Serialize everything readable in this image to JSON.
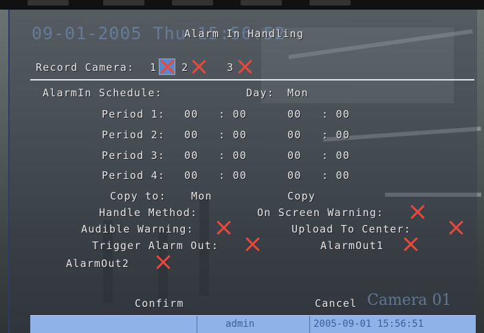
{
  "dialog": {
    "title": "Alarm In Handling",
    "osd_datetime": "09-01-2005 Thu 15:56:52",
    "osd_camera": "Camera 01"
  },
  "record_camera": {
    "label": "Record Camera:",
    "cameras": [
      "1",
      "2",
      "3"
    ],
    "selected": "1"
  },
  "schedule": {
    "label": "AlarmIn Schedule:",
    "day_label": "Day:",
    "day_value": "Mon",
    "periods": [
      {
        "label": "Period 1:",
        "start_h": "00",
        "start_m": ": 00",
        "end_h": "00",
        "end_m": ": 00"
      },
      {
        "label": "Period 2:",
        "start_h": "00",
        "start_m": ": 00",
        "end_h": "00",
        "end_m": ": 00"
      },
      {
        "label": "Period 3:",
        "start_h": "00",
        "start_m": ": 00",
        "end_h": "00",
        "end_m": ": 00"
      },
      {
        "label": "Period 4:",
        "start_h": "00",
        "start_m": ": 00",
        "end_h": "00",
        "end_m": ": 00"
      }
    ],
    "copy_to_label": "Copy to:",
    "copy_to_value": "Mon",
    "copy_button": "Copy"
  },
  "handle": {
    "method_label": "Handle Method:",
    "on_screen_warning": "On Screen Warning:",
    "audible_warning": "Audible Warning:",
    "upload_to_center": "Upload To Center:",
    "trigger_alarm_out": "Trigger Alarm Out:",
    "alarm_out1": "AlarmOut1",
    "alarm_out2": "AlarmOut2"
  },
  "buttons": {
    "confirm": "Confirm",
    "cancel": "Cancel"
  },
  "status_bar": {
    "user": "admin",
    "datetime": "2005-09-01 15:56:51",
    "background_color": "#8fb3e8"
  },
  "colors": {
    "check_mark": "#e8493a",
    "selected_highlight": "#5d86c8",
    "text": "#e6e6ea"
  }
}
